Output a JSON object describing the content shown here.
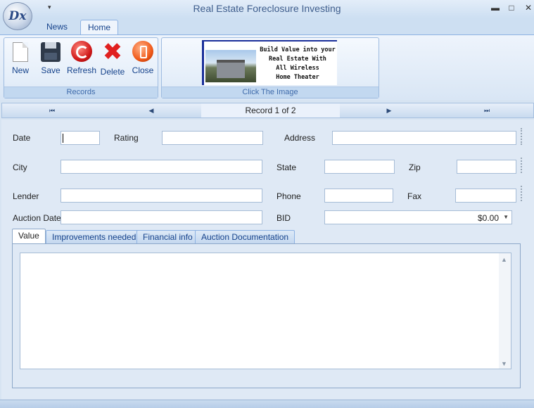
{
  "window": {
    "title": "Real Estate Foreclosure Investing",
    "app_logo_text": "Dx",
    "quick_access_arrow": "▾",
    "minimize": "▬",
    "restore": "□",
    "close": "✕"
  },
  "ribbon": {
    "tabs": [
      {
        "label": "News",
        "active": false
      },
      {
        "label": "Home",
        "active": true
      }
    ],
    "groups": {
      "records": {
        "label": "Records",
        "buttons": {
          "new": "New",
          "save": "Save",
          "refresh": "Refresh",
          "delete": "Delete",
          "close": "Close"
        }
      },
      "image": {
        "label": "Click The Image",
        "ad_lines": [
          "Build Value into your",
          "Real Estate With",
          "All Wireless",
          "Home Theater"
        ]
      }
    }
  },
  "navigator": {
    "first": "⏮",
    "prev": "◀",
    "record_text": "Record 1 of 2",
    "next": "▶",
    "last": "⏭"
  },
  "form": {
    "labels": {
      "date": "Date",
      "rating": "Rating",
      "address": "Address",
      "city": "City",
      "state": "State",
      "zip": "Zip",
      "lender": "Lender",
      "phone": "Phone",
      "fax": "Fax",
      "auction_date": "Auction Date",
      "bid": "BID"
    },
    "values": {
      "date": "",
      "rating": "",
      "address": "",
      "city": "",
      "state": "",
      "zip": "",
      "lender": "",
      "phone": "",
      "fax": "",
      "auction_date": "",
      "bid": "$0.00"
    },
    "tabs": [
      {
        "label": "Value",
        "active": true
      },
      {
        "label": "Improvements needed",
        "active": false
      },
      {
        "label": "Financial info",
        "active": false
      },
      {
        "label": "Auction Documentation",
        "active": false
      }
    ],
    "memo_value": ""
  }
}
